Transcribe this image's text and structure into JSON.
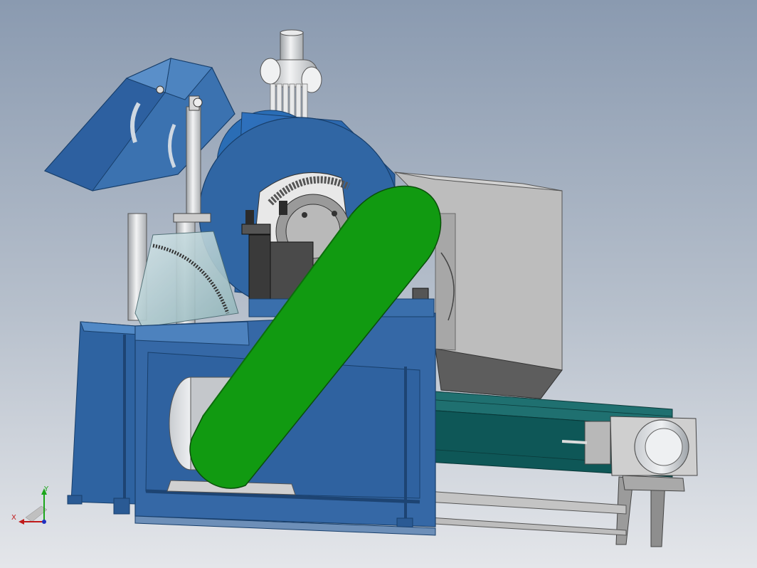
{
  "axes": {
    "x_label": "X",
    "y_label": "Y"
  },
  "colors": {
    "bg_top": "#8d9db2",
    "bg_bottom": "#dfe2e7",
    "machine_blue": "#3566a0",
    "machine_blue_dark": "#244d7e",
    "belt_green": "#0f8a0f",
    "conveyor_teal": "#0e5a5a",
    "hopper_gray": "#b4b4b4",
    "steel_light": "#d7dadd"
  }
}
